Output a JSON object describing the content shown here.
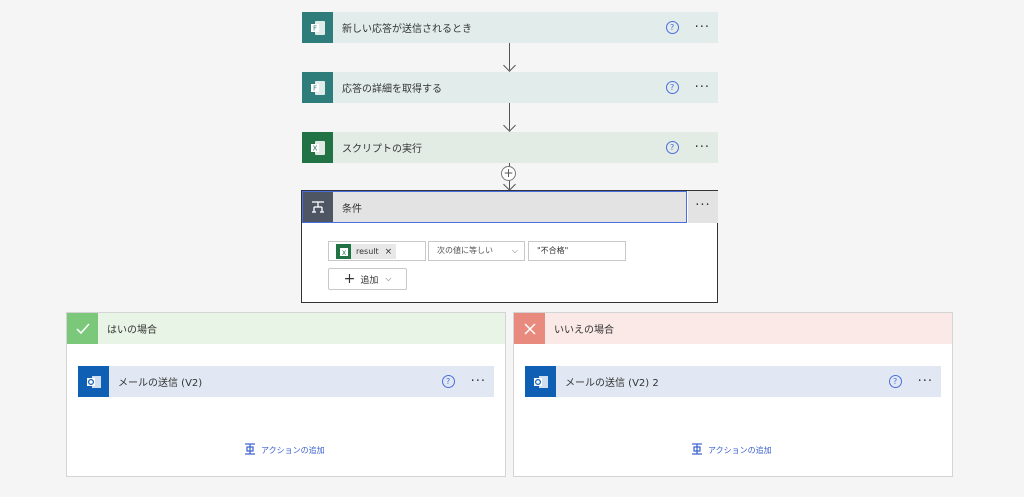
{
  "steps": [
    {
      "title": "新しい応答が送信されるとき",
      "icon": "forms-icon"
    },
    {
      "title": "応答の詳細を取得する",
      "icon": "forms-icon"
    },
    {
      "title": "スクリプトの実行",
      "icon": "excel-icon"
    }
  ],
  "help_glyph": "?",
  "more_glyph": "···",
  "insert_glyph": "+",
  "condition": {
    "title": "条件",
    "token_label": "result",
    "token_remove": "×",
    "operator": "次の値に等しい",
    "value": "\"不合格\"",
    "add_label": "追加",
    "add_plus": "+",
    "chevron": "⌵"
  },
  "branches": {
    "yes": {
      "title": "はいの場合",
      "action_title": "メールの送信 (V2)",
      "add_action": "アクションの追加"
    },
    "no": {
      "title": "いいえの場合",
      "action_title": "メールの送信 (V2) 2",
      "add_action": "アクションの追加"
    }
  },
  "colors": {
    "forms": "#2f7d7b",
    "excel": "#217346",
    "outlook": "#0f5fb5",
    "condition": "#4e5563",
    "yes": "#7cc87a",
    "no": "#e88a7e",
    "link": "#3a5fcf"
  }
}
